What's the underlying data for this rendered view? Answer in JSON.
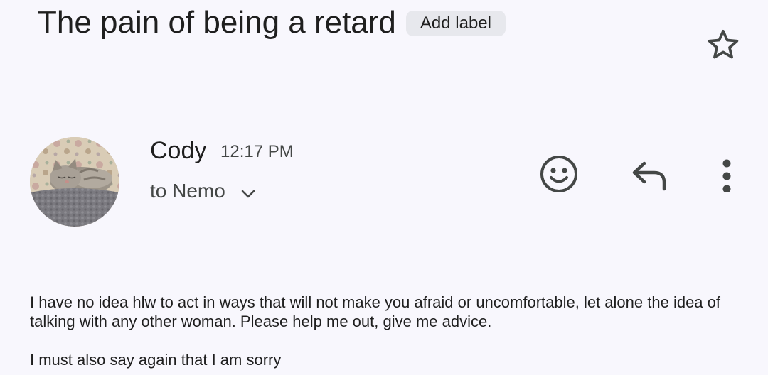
{
  "email": {
    "subject": "The pain of being a retard",
    "add_label": "Add label",
    "sender": {
      "name": "Cody",
      "time": "12:17 PM",
      "recipient": "to Nemo"
    },
    "body": {
      "paragraph_1": "I have no idea hlw to act in ways that will not make you afraid or uncomfortable, let alone the idea of talking with any other woman. Please help me out, give me advice.",
      "paragraph_2": "I must also say again that I am sorry"
    }
  },
  "icons": {
    "star": "star-outline-icon",
    "emoji": "smiley-icon",
    "reply": "reply-icon",
    "more": "more-vertical-icon",
    "expand": "chevron-down-icon"
  },
  "colors": {
    "background": "#f8f7fd",
    "chip": "#e7e8ed",
    "text_primary": "#1f1f1f",
    "text_secondary": "#444746"
  }
}
